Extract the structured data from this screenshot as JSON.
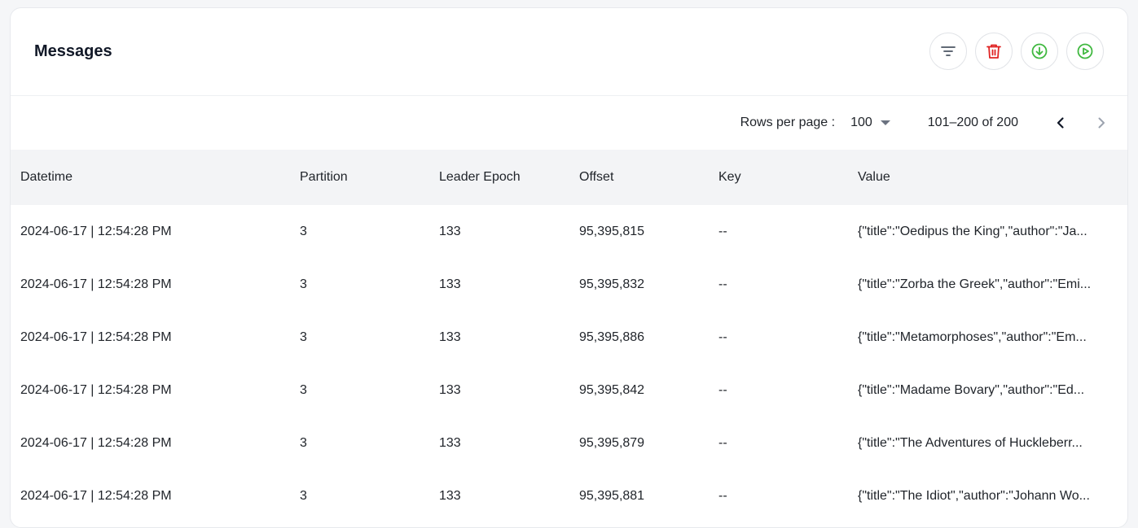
{
  "card": {
    "title": "Messages",
    "actions": [
      {
        "name": "filter-button",
        "icon": "filter-icon",
        "color": "#4b5563"
      },
      {
        "name": "delete-button",
        "icon": "trash-icon",
        "color": "#e02424"
      },
      {
        "name": "download-button",
        "icon": "download-circle-icon",
        "color": "#3fb83f"
      },
      {
        "name": "play-button",
        "icon": "play-circle-icon",
        "color": "#3fb83f"
      }
    ]
  },
  "pagination": {
    "rows_per_page_label": "Rows per page :",
    "rows_per_page_value": "100",
    "range_text": "101–200 of 200",
    "prev_icon": "chevron-left-icon",
    "next_icon": "chevron-right-icon"
  },
  "table": {
    "headers": {
      "datetime": "Datetime",
      "partition": "Partition",
      "leader_epoch": "Leader Epoch",
      "offset": "Offset",
      "key": "Key",
      "value": "Value"
    },
    "rows": [
      {
        "datetime": "2024-06-17 | 12:54:28 PM",
        "partition": "3",
        "leader_epoch": "133",
        "offset": "95,395,815",
        "key": "--",
        "value": "{\"title\":\"Oedipus the King\",\"author\":\"Ja..."
      },
      {
        "datetime": "2024-06-17 | 12:54:28 PM",
        "partition": "3",
        "leader_epoch": "133",
        "offset": "95,395,832",
        "key": "--",
        "value": "{\"title\":\"Zorba the Greek\",\"author\":\"Emi..."
      },
      {
        "datetime": "2024-06-17 | 12:54:28 PM",
        "partition": "3",
        "leader_epoch": "133",
        "offset": "95,395,886",
        "key": "--",
        "value": "{\"title\":\"Metamorphoses\",\"author\":\"Em..."
      },
      {
        "datetime": "2024-06-17 | 12:54:28 PM",
        "partition": "3",
        "leader_epoch": "133",
        "offset": "95,395,842",
        "key": "--",
        "value": "{\"title\":\"Madame Bovary\",\"author\":\"Ed..."
      },
      {
        "datetime": "2024-06-17 | 12:54:28 PM",
        "partition": "3",
        "leader_epoch": "133",
        "offset": "95,395,879",
        "key": "--",
        "value": "{\"title\":\"The Adventures of Huckleberr..."
      },
      {
        "datetime": "2024-06-17 | 12:54:28 PM",
        "partition": "3",
        "leader_epoch": "133",
        "offset": "95,395,881",
        "key": "--",
        "value": "{\"title\":\"The Idiot\",\"author\":\"Johann Wo..."
      }
    ]
  }
}
